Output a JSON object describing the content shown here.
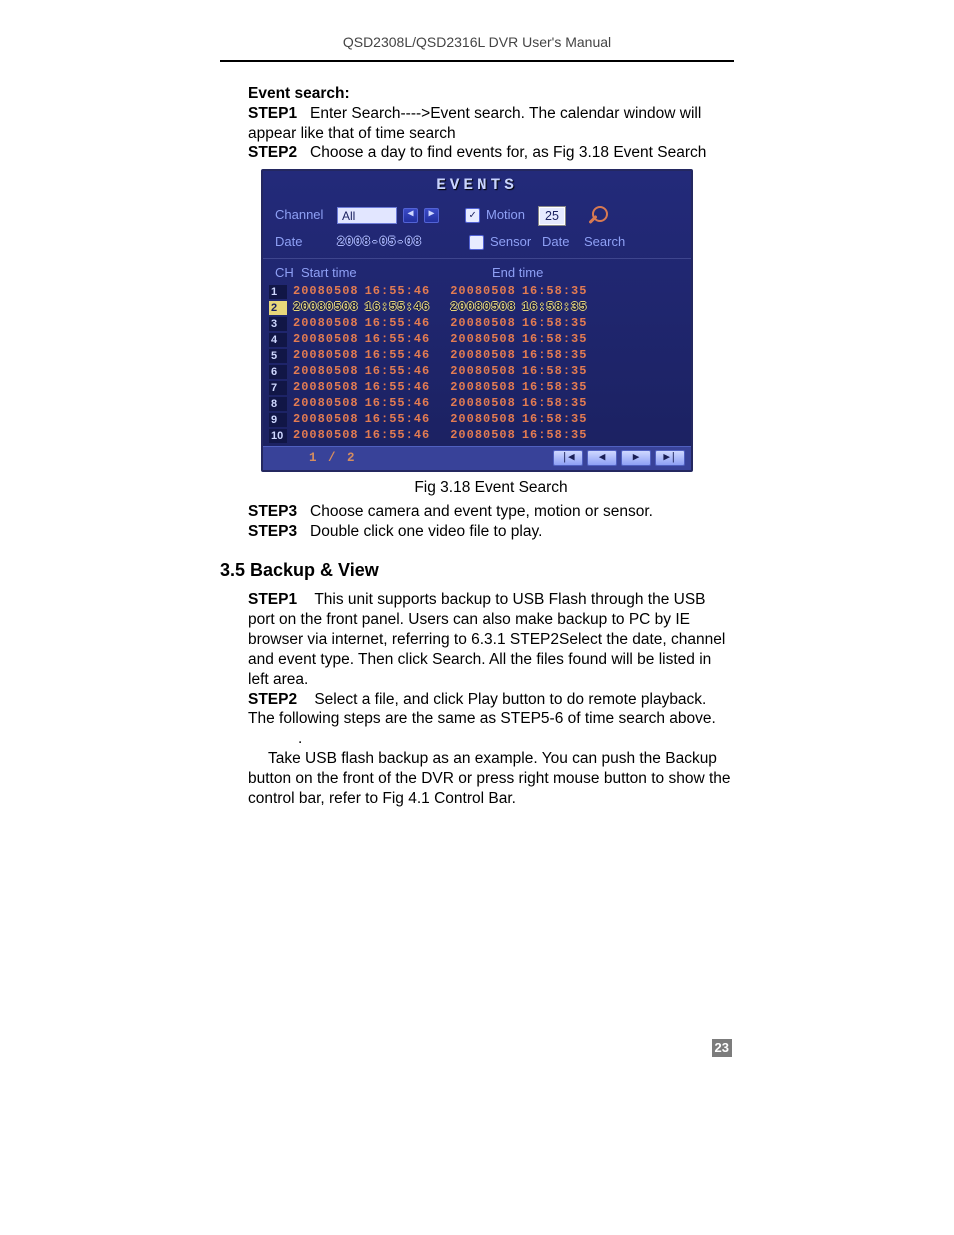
{
  "header": {
    "title": "QSD2308L/QSD2316L DVR User's Manual"
  },
  "event_search": {
    "heading": "Event search:",
    "step1": {
      "label": "STEP1",
      "text": "Enter Search---->Event search. The calendar window will appear like that of time search"
    },
    "step2": {
      "label": "STEP2",
      "text": "Choose a day to find events for, as Fig 3.18 Event Search"
    },
    "caption": "Fig 3.18 Event Search",
    "step3a": {
      "label": "STEP3",
      "text": "Choose camera and event type, motion or sensor."
    },
    "step3b": {
      "label": "STEP3",
      "text": "Double click one video file to play."
    }
  },
  "figure": {
    "title": "EVENTS",
    "labels": {
      "channel": "Channel",
      "date": "Date",
      "motion": "Motion",
      "sensor": "Sensor",
      "date2": "Date",
      "search": "Search"
    },
    "channel_value": "All",
    "date_value": "2008-05-08",
    "calendar_day": "25",
    "columns": {
      "ch": "CH",
      "start": "Start time",
      "end": "End time"
    },
    "rows": [
      {
        "ch": "1",
        "start_d": "20080508",
        "start_t": "16:55:46",
        "end_d": "20080508",
        "end_t": "16:58:35",
        "selected": false
      },
      {
        "ch": "2",
        "start_d": "20080508",
        "start_t": "16:55:46",
        "end_d": "20080508",
        "end_t": "16:58:35",
        "selected": true
      },
      {
        "ch": "3",
        "start_d": "20080508",
        "start_t": "16:55:46",
        "end_d": "20080508",
        "end_t": "16:58:35",
        "selected": false
      },
      {
        "ch": "4",
        "start_d": "20080508",
        "start_t": "16:55:46",
        "end_d": "20080508",
        "end_t": "16:58:35",
        "selected": false
      },
      {
        "ch": "5",
        "start_d": "20080508",
        "start_t": "16:55:46",
        "end_d": "20080508",
        "end_t": "16:58:35",
        "selected": false
      },
      {
        "ch": "6",
        "start_d": "20080508",
        "start_t": "16:55:46",
        "end_d": "20080508",
        "end_t": "16:58:35",
        "selected": false
      },
      {
        "ch": "7",
        "start_d": "20080508",
        "start_t": "16:55:46",
        "end_d": "20080508",
        "end_t": "16:58:35",
        "selected": false
      },
      {
        "ch": "8",
        "start_d": "20080508",
        "start_t": "16:55:46",
        "end_d": "20080508",
        "end_t": "16:58:35",
        "selected": false
      },
      {
        "ch": "9",
        "start_d": "20080508",
        "start_t": "16:55:46",
        "end_d": "20080508",
        "end_t": "16:58:35",
        "selected": false
      },
      {
        "ch": "10",
        "start_d": "20080508",
        "start_t": "16:55:46",
        "end_d": "20080508",
        "end_t": "16:58:35",
        "selected": false
      }
    ],
    "pager": "1 / 2"
  },
  "backup": {
    "heading": "3.5 Backup & View",
    "step1": {
      "label": "STEP1",
      "text": "This unit supports backup to USB Flash through the USB port on the front panel. Users can also make backup to PC by IE browser via internet, referring to 6.3.1 STEP2Select the date, channel and event type. Then click Search. All the files found will be listed in left area."
    },
    "step2": {
      "label": "STEP2",
      "text": "Select a file, and click Play button to do remote playback. The following steps are the same as STEP5-6 of time search above."
    },
    "dot": ".",
    "note": "Take USB flash backup as an example. You can push the Backup button on the front of the DVR or press right mouse button to show the control bar, refer to Fig 4.1 Control Bar."
  },
  "page_number": "23"
}
